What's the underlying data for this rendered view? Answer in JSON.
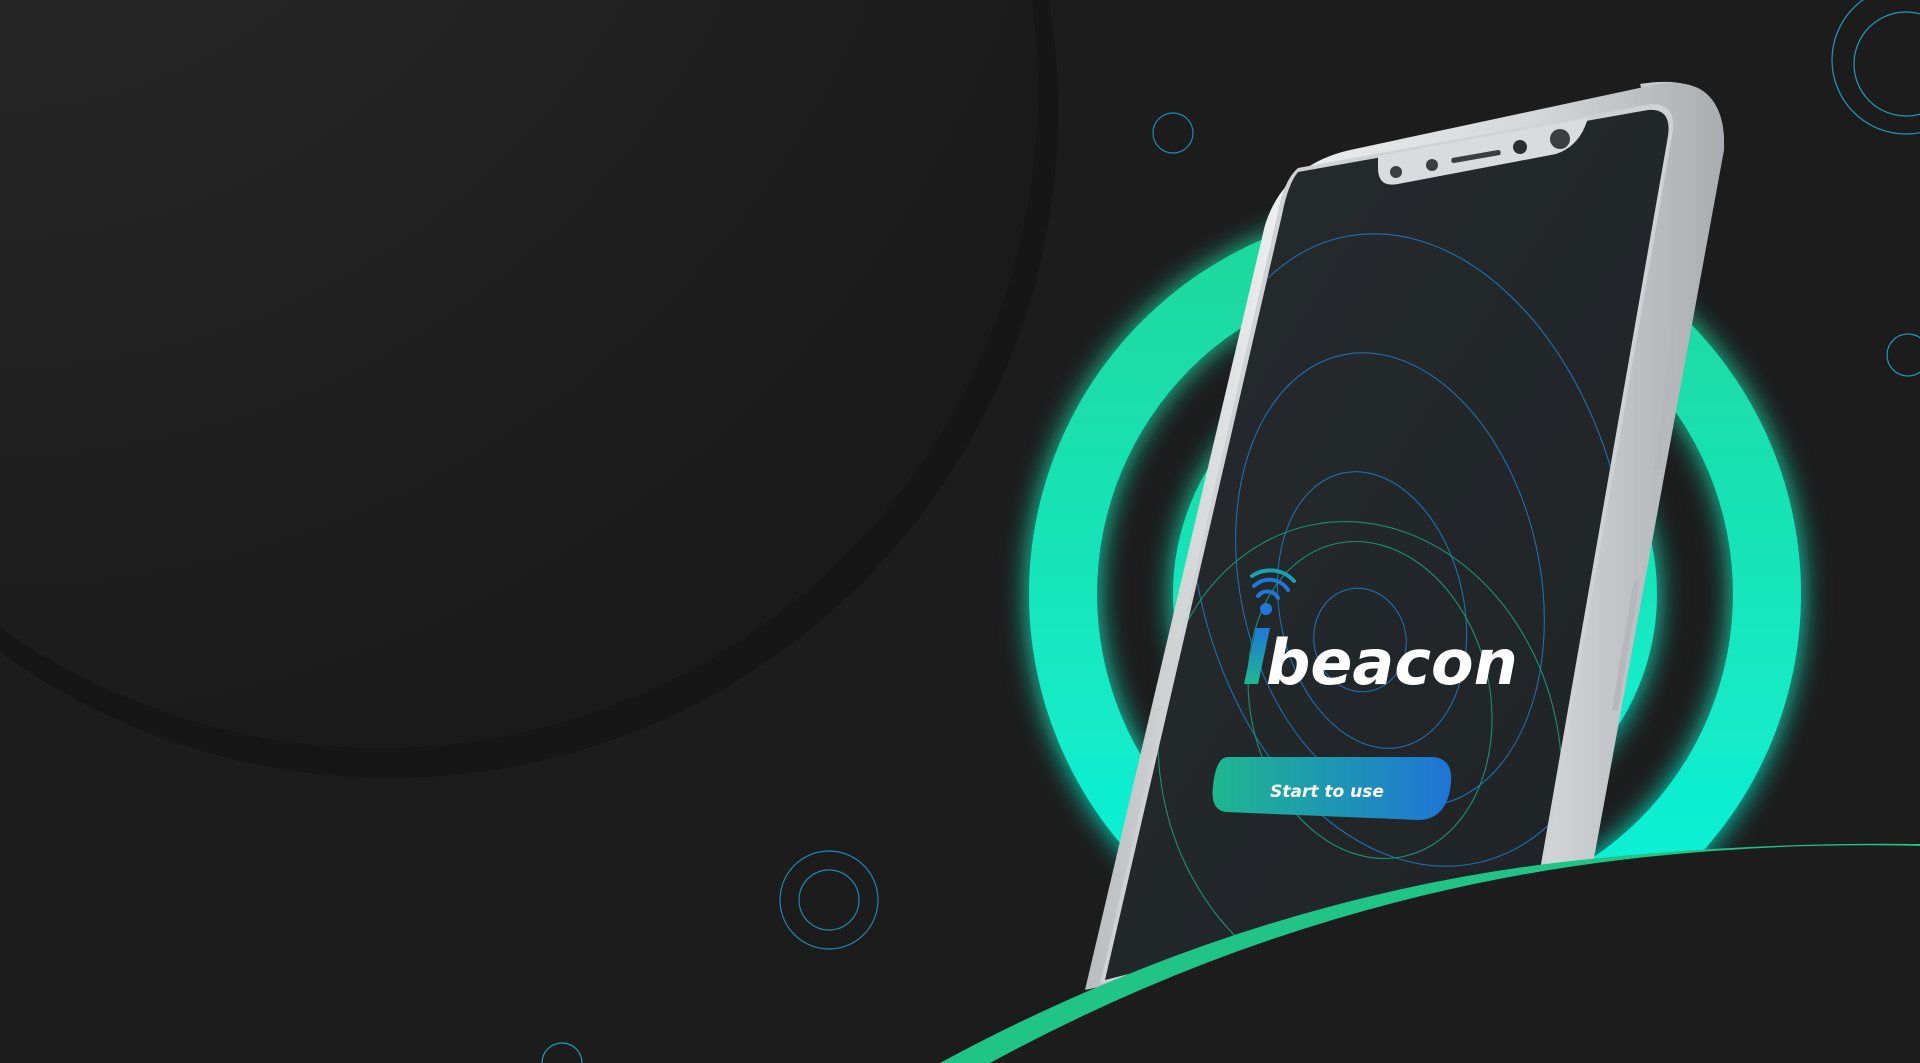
{
  "brand": {
    "logo_text": "beacon",
    "logo_initial": "i",
    "logo_icon": "wifi-signal-icon"
  },
  "cta": {
    "label": "Start to use"
  },
  "colors": {
    "background": "#1c1c1c",
    "ring_top": "#1fd79a",
    "ring_bottom": "#0cf5df",
    "accent_blue": "#1f78d8",
    "accent_green": "#1eb88f",
    "wave_green": "#1fc486",
    "phone_frame": "#dcdedf",
    "screen": "#23282b"
  }
}
